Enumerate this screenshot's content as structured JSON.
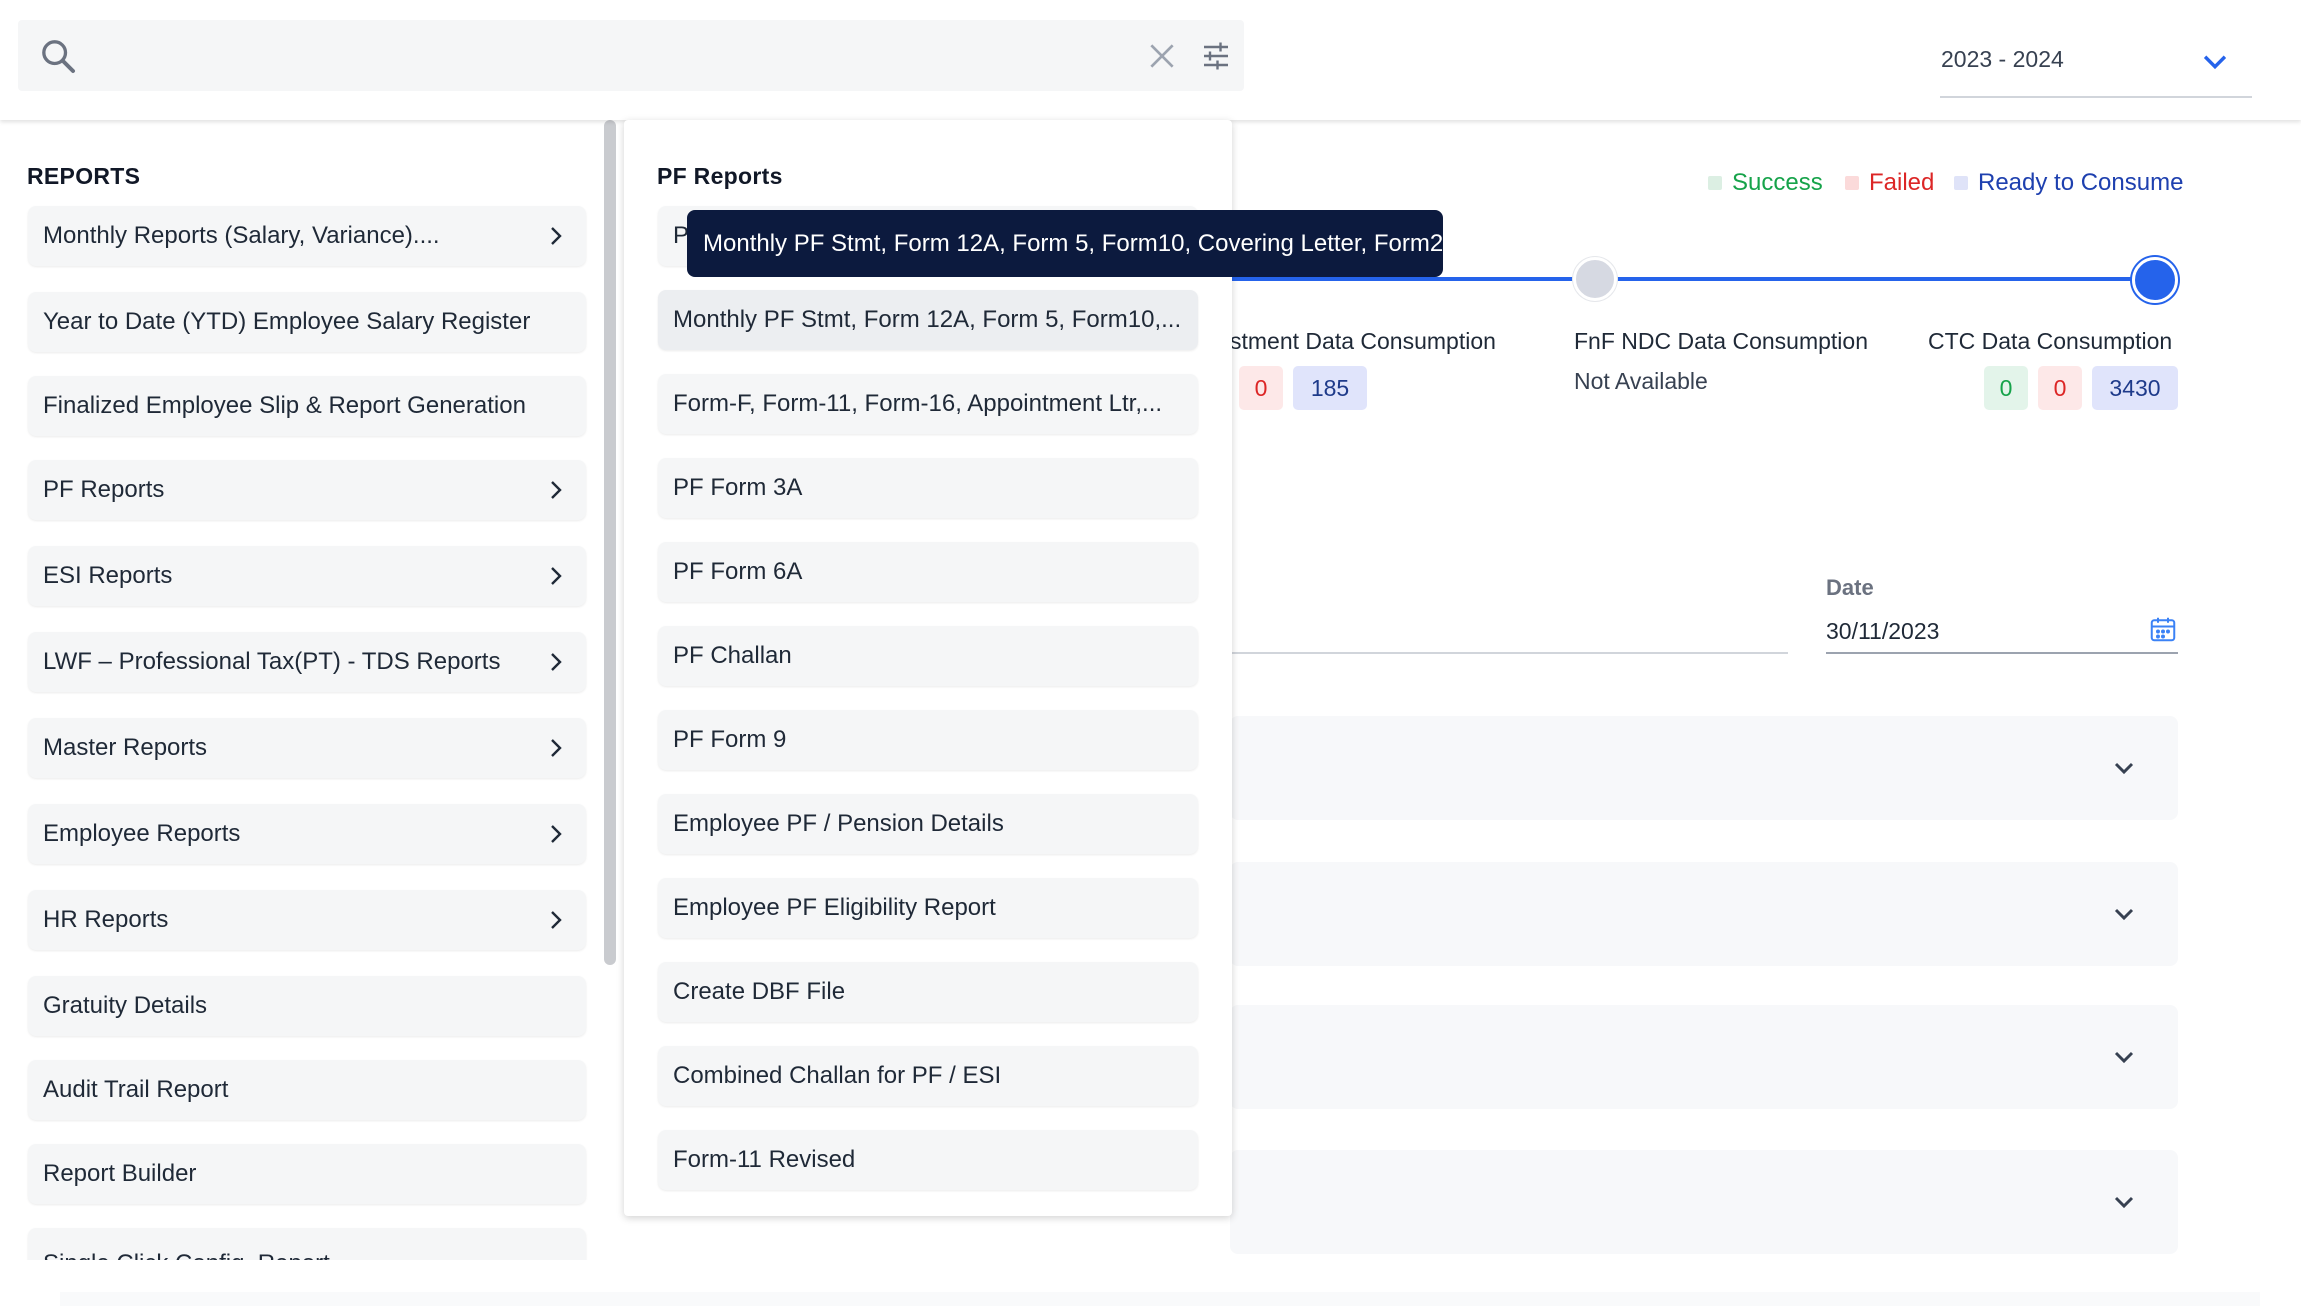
{
  "search": {
    "placeholder": ""
  },
  "year_select": {
    "value": "2023 - 2024"
  },
  "legend": {
    "success": "Success",
    "failed": "Failed",
    "ready": "Ready to Consume"
  },
  "colors": {
    "success": "#16a34a",
    "failed": "#dc2626",
    "ready": "#1e40af",
    "accent": "#2563eb",
    "tooltip_bg": "#0c1a3e"
  },
  "stages": [
    {
      "label": "stment Data Consumption",
      "failed": "0",
      "ready": "185"
    },
    {
      "label": "FnF NDC Data Consumption",
      "status": "Not Available"
    },
    {
      "label": "CTC Data Consumption",
      "success": "0",
      "failed": "0",
      "ready": "3430"
    }
  ],
  "date_field": {
    "label": "Date",
    "value": "30/11/2023"
  },
  "reports_panel": {
    "title": "REPORTS",
    "items": [
      {
        "label": "Monthly Reports (Salary, Variance)....",
        "has_submenu": true
      },
      {
        "label": "Year to Date (YTD) Employee Salary Register",
        "has_submenu": false
      },
      {
        "label": "Finalized Employee Slip & Report Generation",
        "has_submenu": false
      },
      {
        "label": "PF Reports",
        "has_submenu": true
      },
      {
        "label": "ESI Reports",
        "has_submenu": true
      },
      {
        "label": "LWF – Professional Tax(PT) - TDS Reports",
        "has_submenu": true
      },
      {
        "label": "Master Reports",
        "has_submenu": true
      },
      {
        "label": "Employee Reports",
        "has_submenu": true
      },
      {
        "label": "HR Reports",
        "has_submenu": true
      },
      {
        "label": "Gratuity Details",
        "has_submenu": false
      },
      {
        "label": "Audit Trail Report",
        "has_submenu": false
      },
      {
        "label": "Report Builder",
        "has_submenu": false
      },
      {
        "label": "Single Click Config. Report",
        "has_submenu": false
      }
    ]
  },
  "pf_panel": {
    "title": "PF Reports",
    "items": [
      {
        "label": "P"
      },
      {
        "label": "Monthly PF Stmt, Form 12A, Form 5, Form10,..."
      },
      {
        "label": "Form-F, Form-11, Form-16, Appointment Ltr,..."
      },
      {
        "label": "PF Form 3A"
      },
      {
        "label": "PF Form 6A"
      },
      {
        "label": "PF Challan"
      },
      {
        "label": "PF Form 9"
      },
      {
        "label": "Employee PF / Pension Details"
      },
      {
        "label": "Employee PF Eligibility Report"
      },
      {
        "label": "Create DBF File"
      },
      {
        "label": "Combined Challan for PF / ESI"
      },
      {
        "label": "Form-11 Revised"
      }
    ]
  },
  "tooltip": {
    "text": "Monthly PF Stmt, Form 12A, Form 5, Form10, Covering Letter, Form2"
  }
}
